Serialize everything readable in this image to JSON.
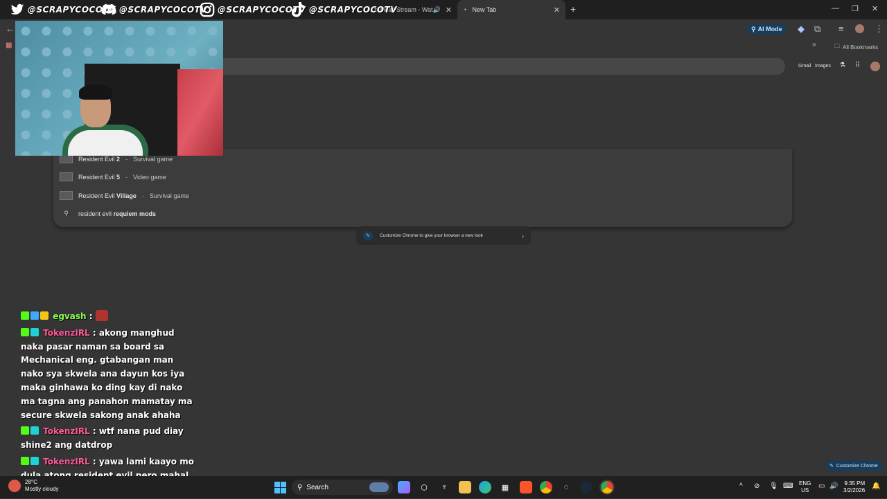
{
  "social": [
    {
      "icon": "twitter-icon",
      "label": "@SCRAPYCOCOTV"
    },
    {
      "icon": "discord-icon",
      "label": "@SCRAPYCOCOTV"
    },
    {
      "icon": "instagram-icon",
      "label": "@SCRAPYCOCOTV"
    },
    {
      "icon": "tiktok-icon",
      "label": "@SCRAPYCOCOTV"
    }
  ],
  "tabs": [
    {
      "title": "ozzofficial Stream - Wat",
      "active": false,
      "audio": true
    },
    {
      "title": "New Tab",
      "active": true,
      "audio": false
    }
  ],
  "toolbar": {
    "ai_mode": "AI Mode",
    "all_bookmarks": "All Bookmarks"
  },
  "ntp": {
    "gmail": "Gmail",
    "images": "Images"
  },
  "suggestions": [
    {
      "prefix": "Resident Evil ",
      "bold": "2",
      "type": "Survival game"
    },
    {
      "prefix": "Resident Evil ",
      "bold": "5",
      "type": "Video game"
    },
    {
      "prefix": "Resident Evil ",
      "bold": "Village",
      "type": "Survival game"
    },
    {
      "prefix": "resident evil ",
      "bold": "requiem mods",
      "type": ""
    }
  ],
  "customize_card": {
    "text": "Customize Chrome to give your browser a new look"
  },
  "customize_button": "Customize Chrome",
  "chat": [
    {
      "user": "egvash",
      "color": "green",
      "message": ""
    },
    {
      "user": "TokenzIRL",
      "color": "pink",
      "message": "akong manghud naka pasar naman sa board sa Mechanical eng. gtabangan man nako sya skwela ana dayun kos iya maka ginhawa ko ding kay di nako ma tagna ang panahon mamatay ma secure skwela sakong anak ahaha"
    },
    {
      "user": "TokenzIRL",
      "color": "pink",
      "message": "wtf nana pud diay shine2 ang datdrop"
    },
    {
      "user": "TokenzIRL",
      "color": "pink",
      "message": "yawa lami kaayo mo dula atong resident evil pero mahal kaayo"
    }
  ],
  "taskbar": {
    "weather_temp": "28°C",
    "weather_desc": "Mostly cloudy",
    "search_label": "Search",
    "lang_1": "ENG",
    "lang_2": "US",
    "time": "9:35 PM",
    "date": "3/2/2026"
  },
  "colors": {
    "background": "#353535",
    "accent": "#1b3c59",
    "kick_green": "#53fc18",
    "chat_pink": "#ff5a9a"
  }
}
